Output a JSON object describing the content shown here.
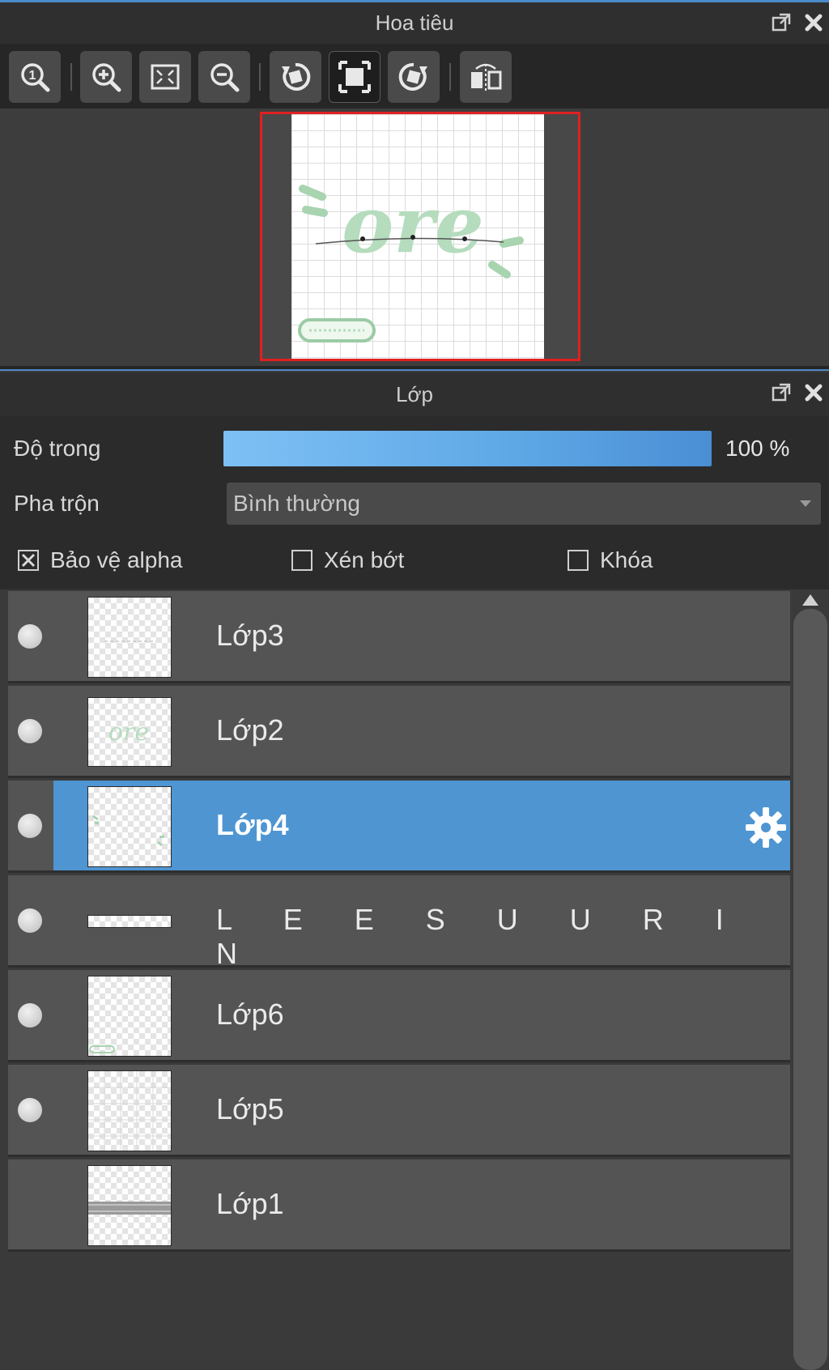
{
  "navigator": {
    "title": "Hoa tiêu",
    "header_icons": [
      "popout-icon",
      "close-icon"
    ],
    "tools": [
      {
        "name": "zoom-actual-size-icon"
      },
      {
        "name": "zoom-in-icon"
      },
      {
        "name": "fit-to-window-icon"
      },
      {
        "name": "zoom-out-icon"
      },
      {
        "name": "rotate-left-icon"
      },
      {
        "name": "fit-canvas-icon",
        "pressed": true
      },
      {
        "name": "rotate-right-icon"
      },
      {
        "name": "flip-horizontal-icon"
      }
    ]
  },
  "layers_panel": {
    "title": "Lớp",
    "opacity_label": "Độ trong",
    "opacity_value": "100 %",
    "opacity_fraction": 1.0,
    "blend_label": "Pha trộn",
    "blend_mode": "Bình thường",
    "checkboxes": {
      "protect_alpha": {
        "label": "Bảo vệ alpha",
        "checked": true
      },
      "clipping": {
        "label": "Xén bớt",
        "checked": false
      },
      "lock": {
        "label": "Khóa",
        "checked": false
      }
    },
    "layers": [
      {
        "name": "Lớp3",
        "visible": true,
        "selected": false
      },
      {
        "name": "Lớp2",
        "visible": true,
        "selected": false
      },
      {
        "name": "Lớp4",
        "visible": true,
        "selected": true
      },
      {
        "name": "L E E S U U R I N",
        "visible": true,
        "selected": false
      },
      {
        "name": "Lớp6",
        "visible": true,
        "selected": false
      },
      {
        "name": "Lớp5",
        "visible": true,
        "selected": false
      },
      {
        "name": "Lớp1",
        "visible": false,
        "selected": false
      }
    ]
  },
  "colors": {
    "accent": "#4e95d2",
    "selection_frame": "#e02020",
    "preview_green": "#a8d4b0"
  }
}
